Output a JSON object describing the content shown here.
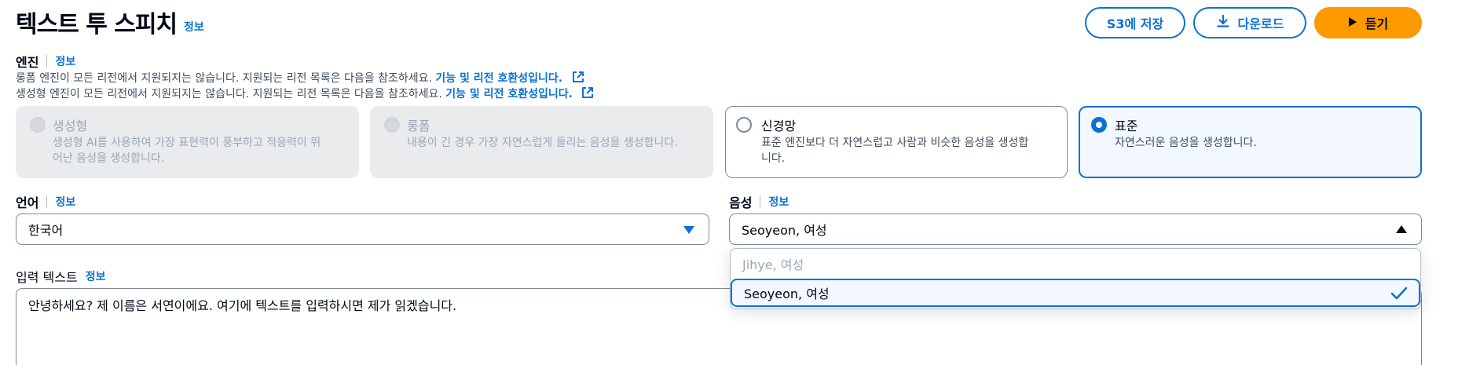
{
  "header": {
    "title": "텍스트 투 스피치",
    "info": "정보",
    "save_s3": "S3에 저장",
    "download": "다운로드",
    "listen": "듣기"
  },
  "engine": {
    "label": "엔진",
    "info": "정보",
    "notes": [
      {
        "text": "롱폼 엔진이 모든 리전에서 지원되지는 않습니다. 지원되는 리전 목록은 다음을 참조하세요.",
        "link": "기능 및 리전 호환성입니다."
      },
      {
        "text": "생성형 엔진이 모든 리전에서 지원되지는 않습니다. 지원되는 리전 목록은 다음을 참조하세요.",
        "link": "기능 및 리전 호환성입니다."
      }
    ],
    "options": [
      {
        "title": "생성형",
        "desc_line1": "생성형 AI를 사용하여 가장 표현력이 풍부하고 적응력이 뛰",
        "desc_line2": "어난 음성을 생성합니다.",
        "state": "disabled"
      },
      {
        "title": "롱폼",
        "desc_line1": "내용이 긴 경우 가장 자연스럽게 들리는 음성을 생성합니다.",
        "desc_line2": "",
        "state": "disabled"
      },
      {
        "title": "신경망",
        "desc_line1": "표준 엔진보다 더 자연스럽고 사람과 비슷한 음성을 생성합",
        "desc_line2": "니다.",
        "state": "enabled"
      },
      {
        "title": "표준",
        "desc_line1": "자연스러운 음성을 생성합니다.",
        "desc_line2": "",
        "state": "selected"
      }
    ]
  },
  "language": {
    "label": "언어",
    "info": "정보",
    "value": "한국어"
  },
  "voice": {
    "label": "음성",
    "info": "정보",
    "value": "Seoyeon, 여성",
    "options": [
      "Jihye, 여성",
      "Seoyeon, 여성"
    ]
  },
  "input_text": {
    "label": "입력 텍스트",
    "info": "정보",
    "value": "안녕하세요? 제 이름은 서연이에요. 여기에 텍스트를 입력하시면 제가 읽겠습니다."
  },
  "colors": {
    "accent": "#0972d3",
    "primary_button": "#ff9900",
    "text": "#000716"
  }
}
